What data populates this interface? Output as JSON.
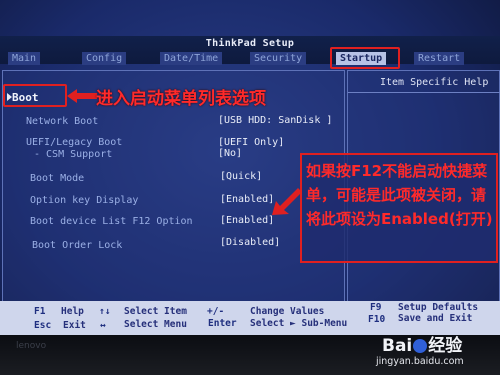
{
  "window": {
    "title": "ThinkPad Setup"
  },
  "tabs": [
    {
      "label": "Main",
      "active": false
    },
    {
      "label": "Config",
      "active": false
    },
    {
      "label": "Date/Time",
      "active": false
    },
    {
      "label": "Security",
      "active": false
    },
    {
      "label": "Startup",
      "active": true
    },
    {
      "label": "Restart",
      "active": false
    }
  ],
  "menu": {
    "selected_item": "Boot",
    "items": [
      {
        "label": "Network Boot",
        "value": "[USB HDD: SanDisk ]"
      },
      {
        "label": "UEFI/Legacy Boot",
        "value": "[UEFI Only]"
      },
      {
        "label": "- CSM Support",
        "value": "[No]"
      },
      {
        "label": "Boot Mode",
        "value": "[Quick]"
      },
      {
        "label": "Option key Display",
        "value": "[Enabled]"
      },
      {
        "label": "Boot device List F12 Option",
        "value": "[Enabled]"
      },
      {
        "label": "Boot Order Lock",
        "value": "[Disabled]"
      }
    ]
  },
  "help_panel": {
    "title": "Item Specific Help"
  },
  "annotations": {
    "boot_note": "进入启动菜单列表选项",
    "f12_note": "如果按F12不能启动快捷菜单，可能是此项被关闭，请将此项设为Enabled(打开)",
    "highlight_color": "#e02020"
  },
  "statusbar": {
    "row1": [
      {
        "key": "F1",
        "text": "Help"
      },
      {
        "key": "↑↓",
        "text": "Select Item"
      },
      {
        "key": "+/-",
        "text": "Change Values"
      },
      {
        "key": "F9",
        "text": "Setup Defaults"
      }
    ],
    "row2": [
      {
        "key": "Esc",
        "text": "Exit"
      },
      {
        "key": "↔",
        "text": "Select Menu"
      },
      {
        "key": "Enter",
        "text": "Select ► Sub-Menu"
      },
      {
        "key": "F10",
        "text": "Save and Exit"
      }
    ]
  },
  "bezel": {
    "brand": "lenovo"
  },
  "watermark": {
    "logo_left": "Bai",
    "logo_right": "经验",
    "url": "jingyan.baidu.com"
  },
  "colors": {
    "bios_background": "#1f3070",
    "active_tab": "#b7c2e6",
    "statusbar": "#cfd6ec",
    "annotation_text": "#ff2a2a"
  }
}
